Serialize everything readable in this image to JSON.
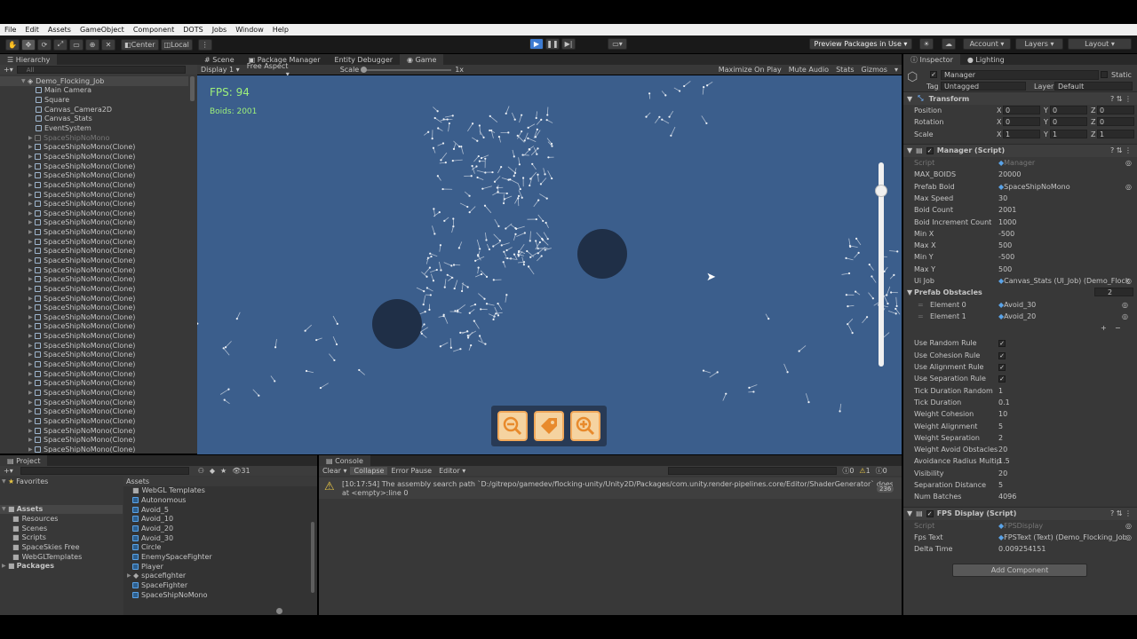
{
  "menu": [
    "File",
    "Edit",
    "Assets",
    "GameObject",
    "Component",
    "DOTS",
    "Jobs",
    "Window",
    "Help"
  ],
  "toolbar": {
    "center": "Center",
    "local": "Local",
    "preview": "Preview Packages in Use",
    "account": "Account",
    "layers": "Layers",
    "layout": "Layout"
  },
  "hierarchy": {
    "tab": "Hierarchy",
    "search": "All",
    "scene": "Demo_Flocking_Job",
    "items": [
      "Main Camera",
      "Square",
      "Canvas_Camera2D",
      "Canvas_Stats",
      "EventSystem"
    ],
    "prefab": "SpaceShipNoMono",
    "clone": "SpaceShipNoMono(Clone)",
    "clone_count": 33
  },
  "center_tabs": {
    "scene": "Scene",
    "pkg": "Package Manager",
    "entity": "Entity Debugger",
    "game": "Game"
  },
  "game_bar": {
    "display": "Display 1",
    "aspect": "Free Aspect",
    "scale_label": "Scale",
    "scale_val": "1x",
    "maximize": "Maximize On Play",
    "mute": "Mute Audio",
    "stats": "Stats",
    "gizmos": "Gizmos"
  },
  "game": {
    "fps": "FPS: 94",
    "boids": "Boids: 2001",
    "slider_level": 0.86
  },
  "project": {
    "tab": "Project",
    "favorites": "Favorites",
    "assets": "Assets",
    "folders": [
      "Resources",
      "Scenes",
      "Scripts",
      "SpaceSkies Free",
      "WebGLTemplates"
    ],
    "packages": "Packages",
    "count": "31",
    "asset_header": "Assets",
    "asset_items": [
      "WebGL Templates",
      "Autonomous",
      "Avoid_5",
      "Avoid_10",
      "Avoid_20",
      "Avoid_30",
      "Circle",
      "EnemySpaceFighter",
      "Player",
      "spacefighter",
      "SpaceFighter",
      "SpaceShipNoMono"
    ]
  },
  "console": {
    "tab": "Console",
    "clear": "Clear",
    "collapse": "Collapse",
    "error_pause": "Error Pause",
    "editor": "Editor",
    "count0": "0",
    "count1": "1",
    "count2": "0",
    "message": "[10:17:54] The assembly search path `D:/gitrepo/gamedev/flocking-unity/Unity2D/Packages/com.unity.render-pipelines.core/Editor/ShaderGenerator` does not exist",
    "message2": "at <empty>:line 0",
    "badge": "236"
  },
  "inspector": {
    "tab": "Inspector",
    "tab2": "Lighting",
    "name": "Manager",
    "static": "Static",
    "tag_label": "Tag",
    "tag": "Untagged",
    "layer_label": "Layer",
    "layer": "Default",
    "transform": "Transform",
    "position": "Position",
    "rotation": "Rotation",
    "scale": "Scale",
    "x": "X",
    "y": "Y",
    "z": "Z",
    "pos": [
      "0",
      "0",
      "0"
    ],
    "rot": [
      "0",
      "0",
      "0"
    ],
    "scl": [
      "1",
      "1",
      "1"
    ],
    "manager_script": "Manager (Script)",
    "fields": [
      [
        "Script",
        "Manager"
      ],
      [
        "MAX_BOIDS",
        "20000"
      ],
      [
        "Prefab Boid",
        "SpaceShipNoMono"
      ],
      [
        "Max Speed",
        "30"
      ],
      [
        "Boid Count",
        "2001"
      ],
      [
        "Boid Increment Count",
        "1000"
      ],
      [
        "Min X",
        "-500"
      ],
      [
        "Max X",
        "500"
      ],
      [
        "Min Y",
        "-500"
      ],
      [
        "Max Y",
        "500"
      ],
      [
        "Ui Job",
        "Canvas_Stats (UI_Job) (Demo_Flock"
      ]
    ],
    "prefab_obstacles": "Prefab Obstacles",
    "obstacle_count": "2",
    "elements": [
      [
        "Element 0",
        "Avoid_30"
      ],
      [
        "Element 1",
        "Avoid_20"
      ]
    ],
    "rules": [
      [
        "Use Random Rule",
        "✓"
      ],
      [
        "Use Cohesion Rule",
        "✓"
      ],
      [
        "Use Alignment Rule",
        "✓"
      ],
      [
        "Use Separation Rule",
        "✓"
      ],
      [
        "Tick Duration Random",
        "1"
      ],
      [
        "Tick Duration",
        "0.1"
      ],
      [
        "Weight Cohesion",
        "10"
      ],
      [
        "Weight Alignment",
        "5"
      ],
      [
        "Weight Separation",
        "2"
      ],
      [
        "Weight Avoid Obstacles",
        "20"
      ],
      [
        "Avoidance Radius Multip",
        "1.5"
      ],
      [
        "Visibility",
        "20"
      ],
      [
        "Separation Distance",
        "5"
      ],
      [
        "Num Batches",
        "4096"
      ]
    ],
    "fps_script": "FPS Display (Script)",
    "fps_fields": [
      [
        "Script",
        "FPSDisplay"
      ],
      [
        "Fps Text",
        "FPSText (Text) (Demo_Flocking_Job"
      ],
      [
        "Delta Time",
        "0.009254151"
      ]
    ],
    "add_component": "Add Component"
  },
  "colors": {
    "game_bg": "#3b5e8c",
    "obstacle": "#1f2f47",
    "accent": "#3d7bd1"
  }
}
